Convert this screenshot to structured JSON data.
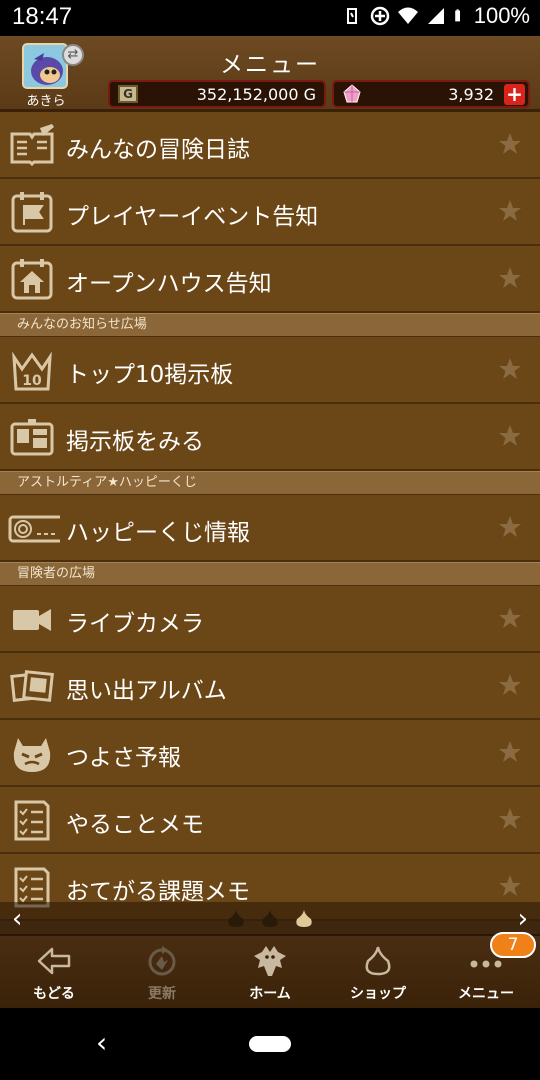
{
  "statusbar": {
    "time": "18:47",
    "battery": "100%"
  },
  "header": {
    "title": "メニュー",
    "player_name": "あきら",
    "gold_amount": "352,152,000 G",
    "gem_amount": "3,932",
    "plus_label": "+"
  },
  "menu": {
    "group1": [
      {
        "label": "みんなの冒険日誌",
        "icon": "book-icon"
      },
      {
        "label": "プレイヤーイベント告知",
        "icon": "calendar-flag-icon"
      },
      {
        "label": "オープンハウス告知",
        "icon": "calendar-house-icon"
      }
    ],
    "section2": "みんなのお知らせ広場",
    "group2": [
      {
        "label": "トップ10掲示板",
        "icon": "crown-10-icon"
      },
      {
        "label": "掲示板をみる",
        "icon": "bulletin-board-icon"
      }
    ],
    "section3": "アストルティア★ハッピーくじ",
    "group3": [
      {
        "label": "ハッピーくじ情報",
        "icon": "lottery-ticket-icon"
      }
    ],
    "section4": "冒険者の広場",
    "group4": [
      {
        "label": "ライブカメラ",
        "icon": "video-camera-icon"
      },
      {
        "label": "思い出アルバム",
        "icon": "photo-album-icon"
      },
      {
        "label": "つよさ予報",
        "icon": "monster-face-icon"
      },
      {
        "label": "やることメモ",
        "icon": "checklist-icon"
      },
      {
        "label": "おてがる課題メモ",
        "icon": "checklist-icon"
      }
    ]
  },
  "bottomnav": {
    "items": [
      {
        "label": "もどる",
        "icon": "back-arrow-icon"
      },
      {
        "label": "更新",
        "icon": "refresh-icon"
      },
      {
        "label": "ホーム",
        "icon": "dragon-home-icon"
      },
      {
        "label": "ショップ",
        "icon": "slime-shop-icon"
      },
      {
        "label": "メニュー",
        "icon": "more-dots-icon"
      }
    ],
    "menu_badge": "7"
  },
  "colors": {
    "row_bg": "#6b4616",
    "section_bg": "#8a6638",
    "accent_red": "#d8241a",
    "badge_orange": "#f08018"
  }
}
